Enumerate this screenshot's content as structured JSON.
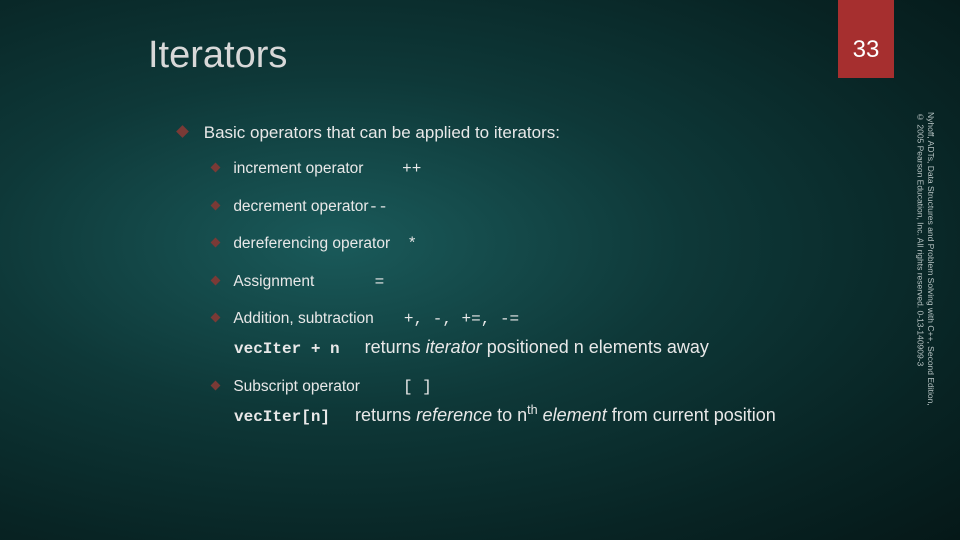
{
  "slide": {
    "title": "Iterators",
    "page_number": "33",
    "citation": "Nyhoff, ADTs, Data Structures and Problem Solving with C++, Second Edition, © 2005 Pearson Education, Inc. All rights reserved. 0-13-140909-3"
  },
  "heading": "Basic operators that can be applied to iterators:",
  "items": [
    {
      "label": "increment operator",
      "op": "++"
    },
    {
      "label": "decrement operator",
      "op": "--"
    },
    {
      "label": "dereferencing operator",
      "op": "*"
    },
    {
      "label": "Assignment",
      "op": "="
    },
    {
      "label": "Addition, subtraction",
      "op": "+, -, +=, -=",
      "desc_mono": "vecIter + n",
      "desc_prefix": "returns ",
      "desc_ital": "iterator",
      "desc_rest": " positioned n elements away"
    },
    {
      "label": "Subscript operator",
      "op": "[ ]",
      "desc_mono": "vecIter[n]",
      "desc_prefix": "returns ",
      "desc_ital": "reference",
      "desc_mid": " to n",
      "desc_sup": "th",
      "desc_ital2": " element",
      "desc_rest": " from current position"
    }
  ]
}
